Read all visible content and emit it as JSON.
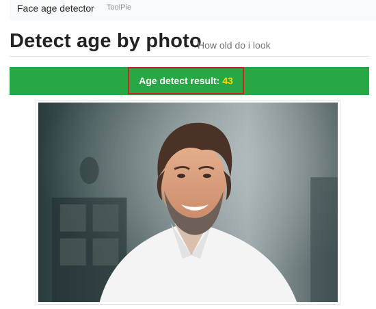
{
  "navbar": {
    "brand": "Face age detector",
    "link": "ToolPie"
  },
  "header": {
    "title": "Detect age by photo",
    "subtitle": "How old do i look"
  },
  "result": {
    "label": "Age detect result:",
    "value": "43"
  },
  "colors": {
    "result_bar": "#28a745",
    "result_value": "#ffd500",
    "highlight_border": "#d62020"
  }
}
